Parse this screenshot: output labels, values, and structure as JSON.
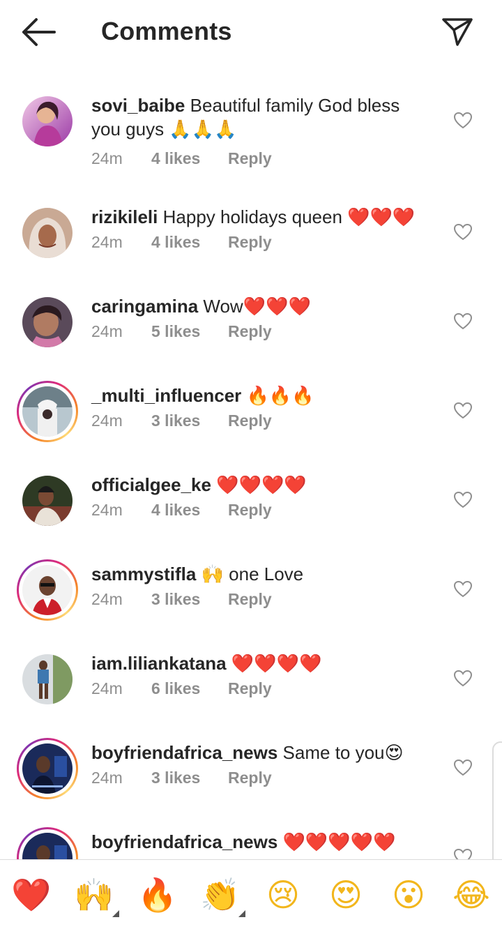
{
  "header": {
    "title": "Comments",
    "back_icon": "arrow-left-icon",
    "send_icon": "paper-plane-icon"
  },
  "comments": [
    {
      "username": "sovi_baibe",
      "text": "Beautiful family God bless you guys",
      "emoji": "🙏🙏🙏",
      "time": "24m",
      "likes": "4 likes",
      "reply": "Reply",
      "story_ring": false
    },
    {
      "username": "rizikileli",
      "text": "Happy holidays queen",
      "emoji": "❤️❤️❤️",
      "time": "24m",
      "likes": "4 likes",
      "reply": "Reply",
      "story_ring": false
    },
    {
      "username": "caringamina",
      "text": "Wow",
      "emoji": "❤️❤️❤️",
      "time": "24m",
      "likes": "5 likes",
      "reply": "Reply",
      "story_ring": false
    },
    {
      "username": "_multi_influencer",
      "text": "",
      "emoji": "🔥🔥🔥",
      "time": "24m",
      "likes": "3 likes",
      "reply": "Reply",
      "story_ring": true
    },
    {
      "username": "officialgee_ke",
      "text": "",
      "emoji": "❤️❤️❤️❤️",
      "time": "24m",
      "likes": "4 likes",
      "reply": "Reply",
      "story_ring": false
    },
    {
      "username": "sammystifla",
      "text": "one Love",
      "emoji": "🙌",
      "time": "24m",
      "likes": "3 likes",
      "reply": "Reply",
      "story_ring": true
    },
    {
      "username": "iam.liliankatana",
      "text": "",
      "emoji": "❤️❤️❤️❤️",
      "time": "24m",
      "likes": "6 likes",
      "reply": "Reply",
      "story_ring": false
    },
    {
      "username": "boyfriendafrica_news",
      "text": "Same to you",
      "emoji": "😍",
      "time": "24m",
      "likes": "3 likes",
      "reply": "Reply",
      "story_ring": true
    },
    {
      "username": "boyfriendafrica_news",
      "text": "",
      "emoji": "❤️❤️❤️❤️❤️",
      "time": "",
      "likes": "",
      "reply": "",
      "story_ring": true
    }
  ],
  "emoji_bar": [
    {
      "emoji": "❤️",
      "name": "red-heart-emoji"
    },
    {
      "emoji": "🙌",
      "name": "raising-hands-emoji"
    },
    {
      "emoji": "🔥",
      "name": "fire-emoji"
    },
    {
      "emoji": "👏",
      "name": "clapping-hands-emoji"
    },
    {
      "emoji": "😢",
      "name": "crying-face-emoji"
    },
    {
      "emoji": "😍",
      "name": "heart-eyes-emoji"
    },
    {
      "emoji": "😮",
      "name": "surprised-face-emoji"
    },
    {
      "emoji": "😂",
      "name": "tears-of-joy-emoji"
    }
  ],
  "colors": {
    "text": "#262626",
    "meta": "#8e8e8e",
    "heart_emoji": "#e0222a",
    "story_ring_start": "#f58529",
    "story_ring_end": "#dd2a7b"
  }
}
